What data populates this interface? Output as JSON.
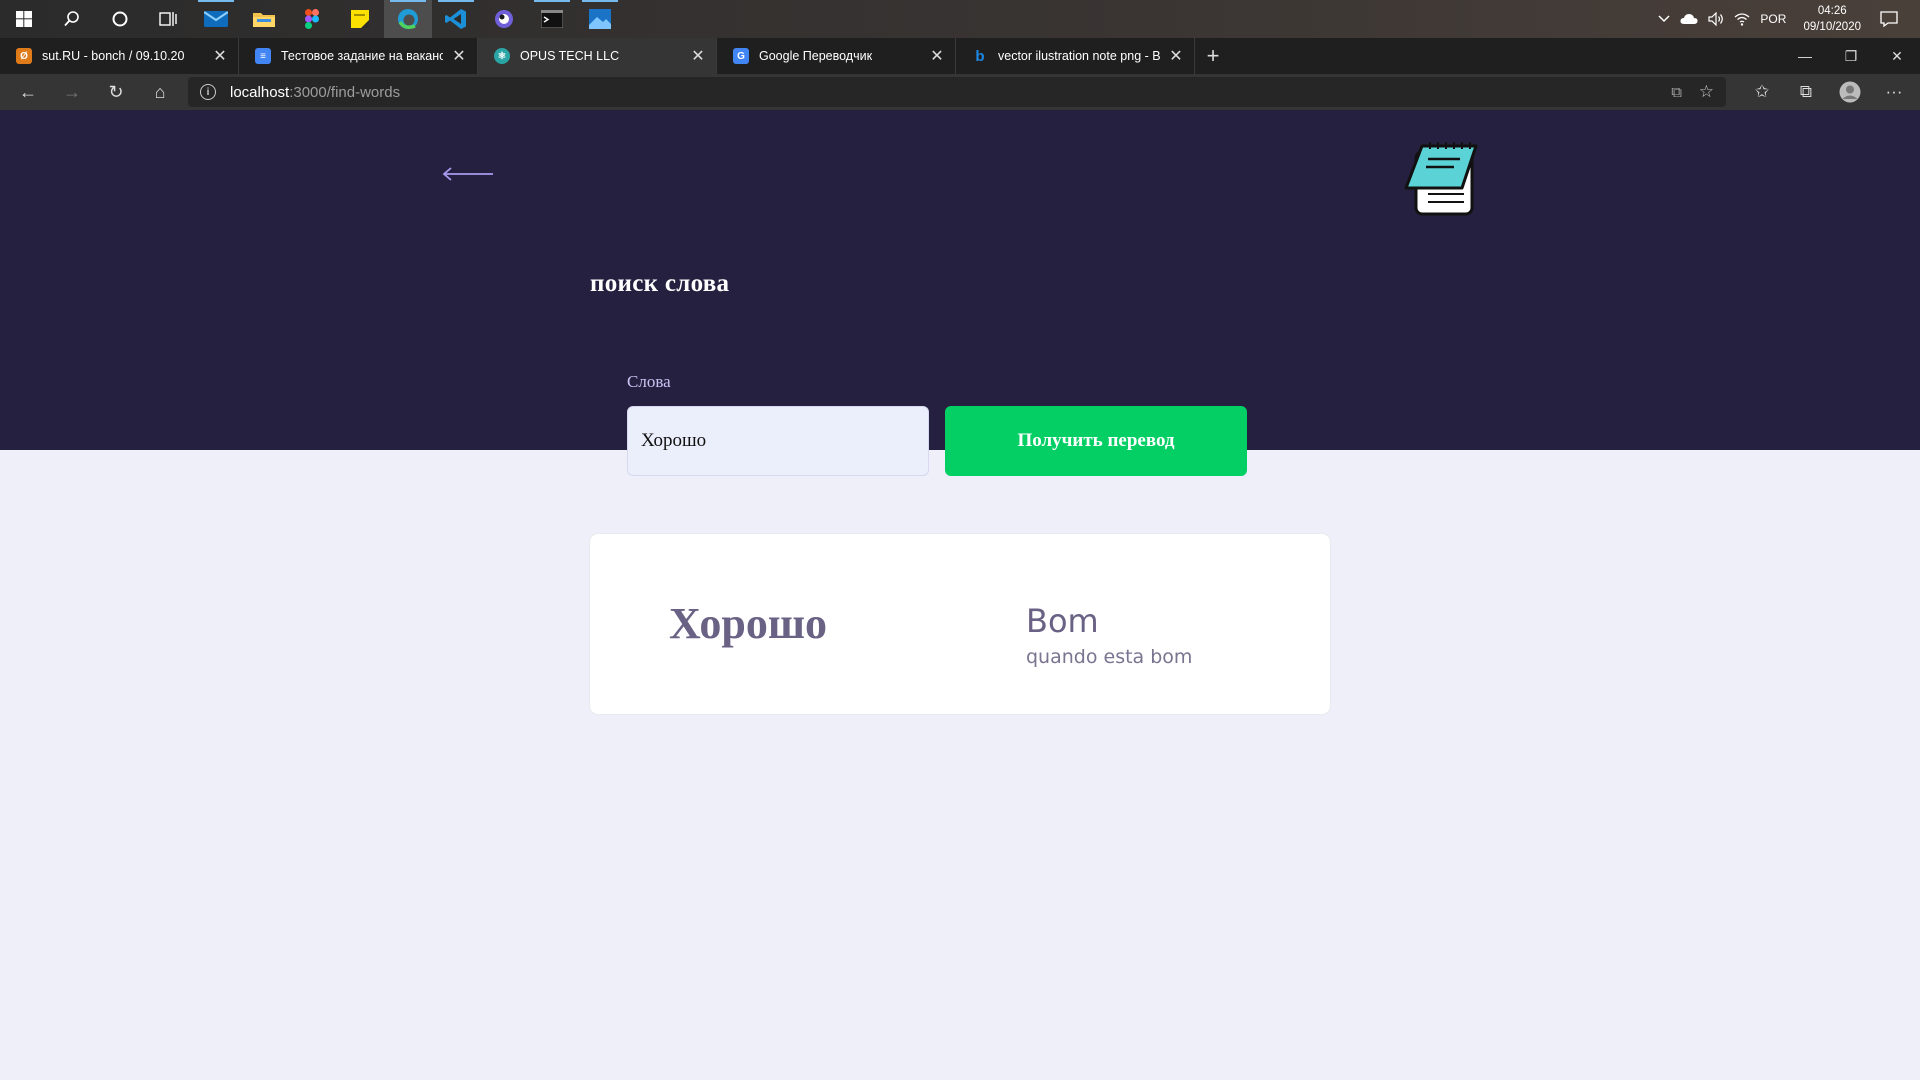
{
  "taskbar": {
    "apps": [
      {
        "icon": "windows-start-icon"
      },
      {
        "icon": "search-icon"
      },
      {
        "icon": "cortana-icon"
      },
      {
        "icon": "task-view-icon"
      },
      {
        "icon": "mail-icon"
      },
      {
        "icon": "file-explorer-icon"
      },
      {
        "icon": "figma-icon"
      },
      {
        "icon": "sticky-notes-icon"
      },
      {
        "icon": "edge-icon"
      },
      {
        "icon": "vscode-icon"
      },
      {
        "icon": "app-icon"
      },
      {
        "icon": "terminal-icon"
      },
      {
        "icon": "photos-icon"
      }
    ],
    "language": "POR",
    "time": "04:26",
    "date": "09/10/2020"
  },
  "browser": {
    "tabs": [
      {
        "title": "sut.RU - bonch / 09.10.20",
        "favicon_color": "#e07b1a",
        "active": false
      },
      {
        "title": "Тестовое задание на вакансию",
        "favicon_color": "#4285f4",
        "active": false
      },
      {
        "title": "OPUS TECH LLC",
        "favicon_color": "#2aa5a5",
        "active": true
      },
      {
        "title": "Google Переводчик",
        "favicon_color": "#4285f4",
        "active": false
      },
      {
        "title": "vector ilustration note png - Bing",
        "favicon_color": "#1e88e5",
        "active": false
      }
    ],
    "url_host": "localhost",
    "url_path": ":3000/find-words"
  },
  "page": {
    "title": "поиск слова",
    "field_label": "Слова",
    "input_value": "Хорошо",
    "button_label": "Получить перевод",
    "result": {
      "source_word": "Хорошо",
      "translation": "Bom",
      "description": "quando esta bom"
    }
  },
  "colors": {
    "header_bg": "#25203f",
    "page_bg": "#efeff9",
    "accent_green": "#03cf64",
    "arrow": "#a79cf0"
  }
}
